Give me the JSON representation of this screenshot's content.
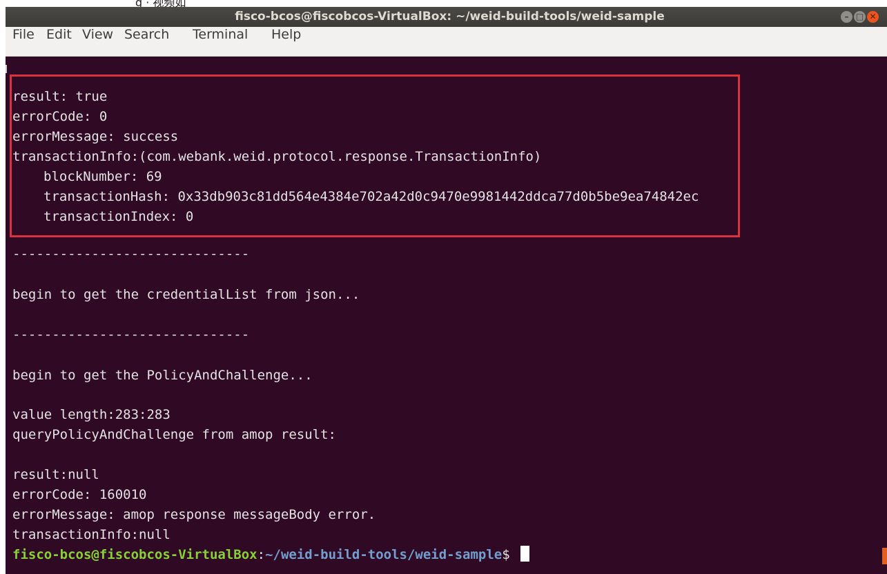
{
  "top_strip": {
    "text": "g · 视频如"
  },
  "window": {
    "title": "fisco-bcos@fiscobcos-VirtualBox: ~/weid-build-tools/weid-sample",
    "controls": {
      "minimize": "–",
      "maximize": "□",
      "close": "✕"
    }
  },
  "menu": {
    "items": [
      {
        "label": "File"
      },
      {
        "label": "Edit"
      },
      {
        "label": "View"
      },
      {
        "label": "Search"
      },
      {
        "label": "Terminal"
      },
      {
        "label": "Help"
      }
    ]
  },
  "terminal": {
    "lines": [
      {
        "text": "result: true"
      },
      {
        "text": "errorCode: 0"
      },
      {
        "text": "errorMessage: success"
      },
      {
        "text": "transactionInfo:(com.webank.weid.protocol.response.TransactionInfo)"
      },
      {
        "text": "blockNumber: 69"
      },
      {
        "text": "transactionHash: 0x33db903c81dd564e4384e702a42d0c9470e9981442ddca77d0b5be9ea74842ec"
      },
      {
        "text": "transactionIndex: 0"
      },
      {
        "text": "------------------------------"
      },
      {
        "text": "begin to get the credentialList from json..."
      },
      {
        "text": "------------------------------"
      },
      {
        "text": "begin to get the PolicyAndChallenge..."
      },
      {
        "text": "value length:283:283"
      },
      {
        "text": "queryPolicyAndChallenge from amop result:"
      },
      {
        "text": "result:null"
      },
      {
        "text": "errorCode: 160010"
      },
      {
        "text": "errorMessage: amop response messageBody error."
      },
      {
        "text": "transactionInfo:null"
      }
    ],
    "prompt": {
      "user_host": "fisco-bcos@fiscobcos-VirtualBox",
      "separator": ":",
      "path": "~/weid-build-tools/weid-sample",
      "symbol": "$ "
    }
  },
  "colors": {
    "terminal_bg": "#300a24",
    "terminal_fg": "#e3e3e3",
    "prompt_user": "#87d335",
    "prompt_path": "#729fcf",
    "highlight_border": "#d9333d",
    "close_button": "#e9541f"
  }
}
